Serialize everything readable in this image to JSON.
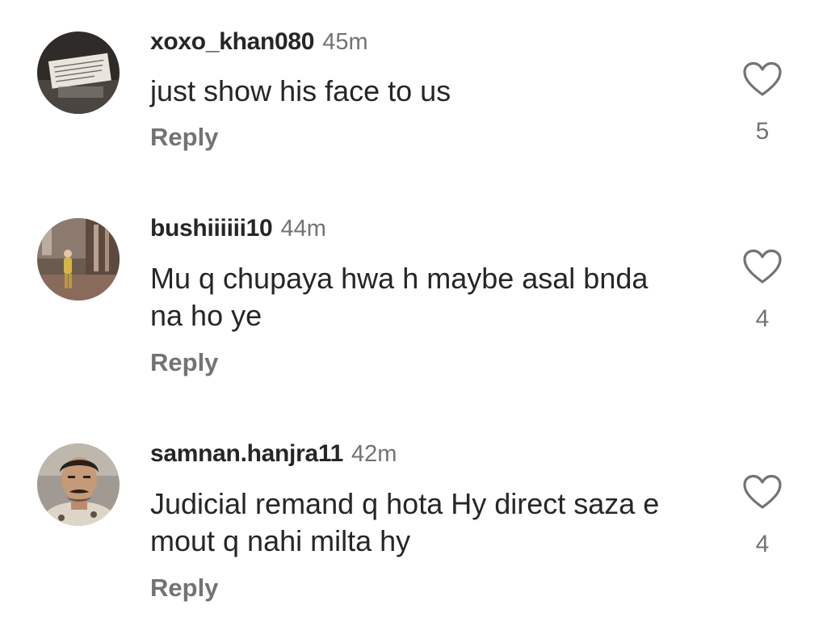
{
  "comments": [
    {
      "username": "xoxo_khan080",
      "time": "45m",
      "text": "just show his face to us",
      "reply_label": "Reply",
      "likes": "5",
      "avatar_icon": "avatar-photo-note-card"
    },
    {
      "username": "bushiiiiii10",
      "time": "44m",
      "text": "Mu q chupaya hwa h maybe asal bnda na ho ye",
      "reply_label": "Reply",
      "likes": "4",
      "avatar_icon": "avatar-photo-person-mall"
    },
    {
      "username": "samnan.hanjra11",
      "time": "42m",
      "text": "Judicial remand q hota Hy direct saza e mout q nahi milta hy",
      "reply_label": "Reply",
      "likes": "4",
      "avatar_icon": "avatar-photo-man-mustache"
    }
  ],
  "colors": {
    "text_primary": "#262626",
    "text_secondary": "#737373",
    "background": "#ffffff"
  },
  "icons": {
    "like": "heart-outline-icon"
  }
}
